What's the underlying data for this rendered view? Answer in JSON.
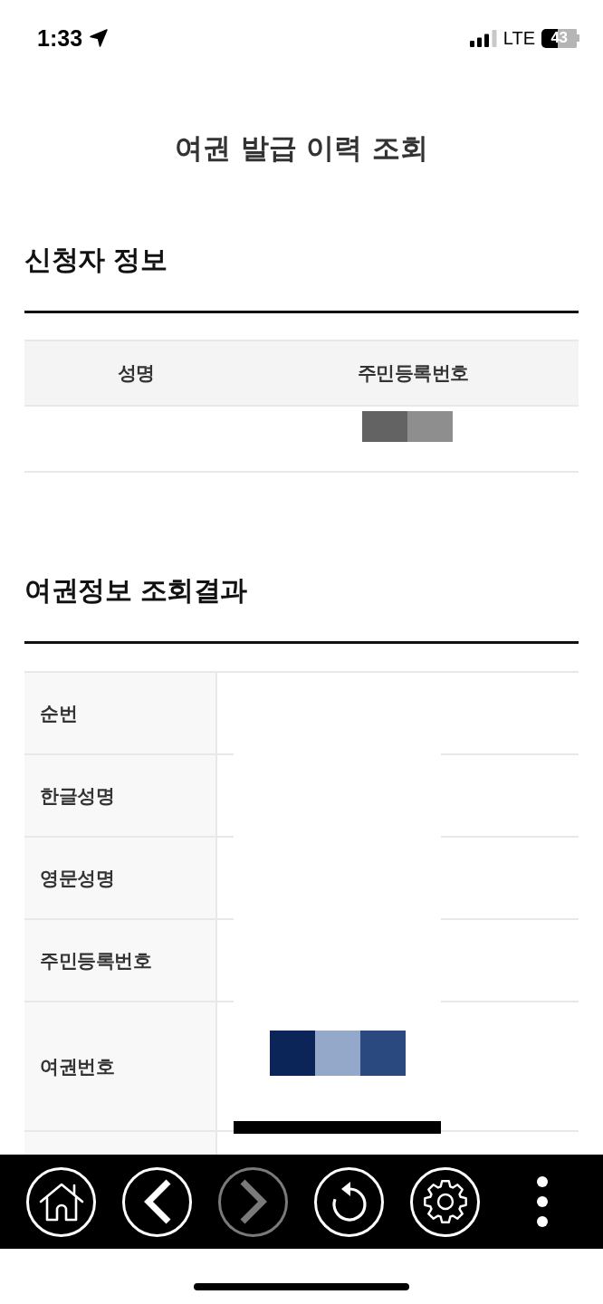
{
  "status_bar": {
    "time": "1:33",
    "network": "LTE",
    "battery": "43"
  },
  "page_title": "여권 발급 이력 조회",
  "applicant_section": {
    "title": "신청자 정보",
    "columns": [
      "성명",
      "주민등록번호"
    ],
    "rows": [
      {
        "cells": [
          {
            "kind": "blank"
          },
          {
            "kind": "mosaic",
            "tiles": [
              {
                "color": "#636363"
              },
              {
                "color": "#8e8e8e"
              }
            ]
          }
        ]
      }
    ]
  },
  "passport_section": {
    "title": "여권정보 조회결과",
    "rows": [
      {
        "label": "순번",
        "black_bar": false,
        "value": {
          "kind": "blank"
        }
      },
      {
        "label": "한글성명",
        "whiteout": true,
        "black_bar": false,
        "value": {
          "kind": "blank"
        }
      },
      {
        "label": "영문성명",
        "whiteout": true,
        "black_bar": false,
        "value": {
          "kind": "blank"
        }
      },
      {
        "label": "주민등록번호",
        "whiteout": true,
        "black_bar": false,
        "value": {
          "kind": "blank"
        }
      },
      {
        "label": "여권번호",
        "whiteout": true,
        "black_bar": true,
        "value": {
          "kind": "mosaic",
          "tiles": [
            {
              "color": "#0b2559"
            },
            {
              "color": "#94a9c9"
            },
            {
              "color": "#2a4a7f"
            }
          ]
        }
      },
      {
        "value": {
          "kind": "blank"
        }
      }
    ]
  },
  "toolbar": {
    "buttons": [
      {
        "kind": "home",
        "disabled": false
      },
      {
        "kind": "back",
        "disabled": false
      },
      {
        "kind": "forward",
        "disabled": true
      },
      {
        "kind": "reload",
        "disabled": false
      },
      {
        "kind": "settings",
        "disabled": false
      },
      {
        "kind": "more",
        "disabled": false
      }
    ]
  }
}
